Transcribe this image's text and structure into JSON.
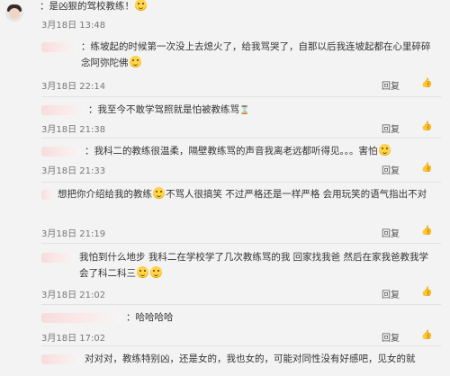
{
  "comments": [
    {
      "id": "c0",
      "text": "：是凶狠的驾校教练！",
      "time": "3月18日 13:48",
      "emoji": true
    },
    {
      "id": "c1",
      "text_a": "：练坡起的时候第一次没上去熄火了，给我骂哭了，自那以后我连坡起都在心里碎碎念阿弥陀佛",
      "time": "3月18日 22:14",
      "reply": "回复",
      "emoji": true
    },
    {
      "id": "c2",
      "text": "：我至今不敢学驾照就是怕被教练骂",
      "time": "3月18日 21:38",
      "reply": "回复"
    },
    {
      "id": "c3",
      "text": "：我科二的教练很温柔，隔壁教练骂的声音我离老远都听得见。。。害怕",
      "time": "3月18日 21:33",
      "reply": "回复"
    },
    {
      "id": "c4",
      "text_a": "想把你介绍给我的教练",
      "text_b": "不骂人很搞笑 不过严格还是一样严格 会用玩笑的语气指出不对",
      "time": "3月18日 21:19",
      "reply": "回复"
    },
    {
      "id": "c5",
      "text": "我怕到什么地步 我科二在学校学了几次教练骂的我 回家找我爸 然后在家我爸教我学会了科二科三",
      "time": "3月18日 21:02",
      "reply": "回复"
    },
    {
      "id": "c6",
      "text": "：哈哈哈哈",
      "time": "3月18日 17:02",
      "reply": "回复"
    },
    {
      "id": "c7",
      "text": "对对对，教练特别凶，还是女的，我也女的，可能对同性没有好感吧，见女的就"
    }
  ],
  "icons": {
    "like": "thumb-up-icon"
  }
}
